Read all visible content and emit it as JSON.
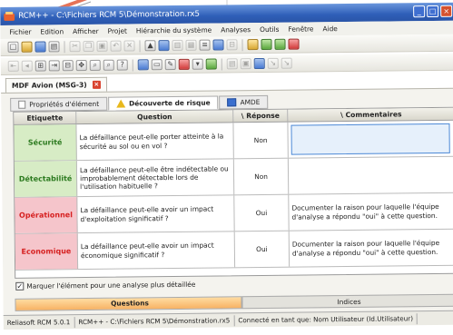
{
  "window": {
    "title": "RCM++ - C:\\Fichiers RCM 5\\Démonstration.rx5",
    "buttons": {
      "minimize": "_",
      "maximize": "□",
      "close": "×"
    }
  },
  "menu": [
    "Fichier",
    "Edition",
    "Afficher",
    "Projet",
    "Hiérarchie du système",
    "Analyses",
    "Outils",
    "Fenêtre",
    "Aide"
  ],
  "toolbar1_icons": [
    "new-icon",
    "open-icon",
    "save-icon",
    "print-icon",
    "cut-icon",
    "copy-icon",
    "paste-icon",
    "undo-icon",
    "delete-icon",
    "up-icon",
    "table-icon",
    "chart-icon",
    "report-icon",
    "warn-icon",
    "filter-icon",
    "tree-icon",
    "help-icon"
  ],
  "toolbar2_icons": [
    "nav-first-icon",
    "nav-prev-icon",
    "expand-icon",
    "collapse-icon",
    "move-icon",
    "search-icon",
    "find-next-icon",
    "find-prev-icon",
    "tool-a-icon",
    "tool-b-icon",
    "tool-c-icon",
    "tool-d-icon",
    "dropdown-icon",
    "tool-e-icon",
    "tool-f-icon",
    "tool-g-icon",
    "tool-h-icon",
    "tool-i-icon",
    "tool-j-icon"
  ],
  "document_tab": {
    "label": "MDF Avion (MSG-3)",
    "close": "×"
  },
  "subtabs": [
    {
      "label": "Propriétés d'élément",
      "icon": "properties-icon"
    },
    {
      "label": "Découverte de risque",
      "icon": "warning-icon"
    },
    {
      "label": "AMDE",
      "icon": "amde-icon"
    }
  ],
  "grid": {
    "headers": {
      "etiquette": "Etiquette",
      "question": "Question",
      "reponse": "\\ Réponse",
      "commentaires": "\\ Commentaires"
    },
    "rows": [
      {
        "etiquette": "Sécurité",
        "color": "#d7ecc5",
        "question": "La défaillance peut-elle porter atteinte à la sécurité au sol ou en vol ?",
        "reponse": "Non",
        "commentaire": ""
      },
      {
        "etiquette": "Détectabilité",
        "color": "#d7ecc5",
        "question": "La défaillance peut-elle être indétectable ou improbablement détectable lors de l'utilisation habituelle ?",
        "reponse": "Non",
        "commentaire": ""
      },
      {
        "etiquette": "Opérationnel",
        "color": "#f5c5cb",
        "question": "La défaillance peut-elle avoir un impact d'exploitation significatif ?",
        "reponse": "Oui",
        "commentaire": "Documenter la raison pour laquelle l'équipe d'analyse a répondu \"oui\" à cette question."
      },
      {
        "etiquette": "Economique",
        "color": "#f5c5cb",
        "question": "La défaillance peut-elle avoir un impact économique significatif ?",
        "reponse": "Oui",
        "commentaire": "Documenter la raison pour laquelle l'équipe d'analyse a répondu \"oui\" à cette question."
      }
    ]
  },
  "checkbox": {
    "label": "Marquer l'élément pour une analyse plus détaillée",
    "checked": "✓"
  },
  "bottom_tabs": {
    "questions": "Questions",
    "indices": "Indices"
  },
  "status": [
    "Reliasoft RCM 5.0.1",
    "RCM++ - C:\\Fichiers RCM 5\\Démonstration.rx5",
    "Connecté en tant que: Nom Utilisateur (Id.Utilisateur)"
  ],
  "colors": {
    "title": "#2f5fb8",
    "safe": "#d7ecc5",
    "risk": "#f5c5cb",
    "risk_text": "#d62020",
    "safe_text": "#2c7a1f",
    "active_tab": "#f7b264"
  }
}
